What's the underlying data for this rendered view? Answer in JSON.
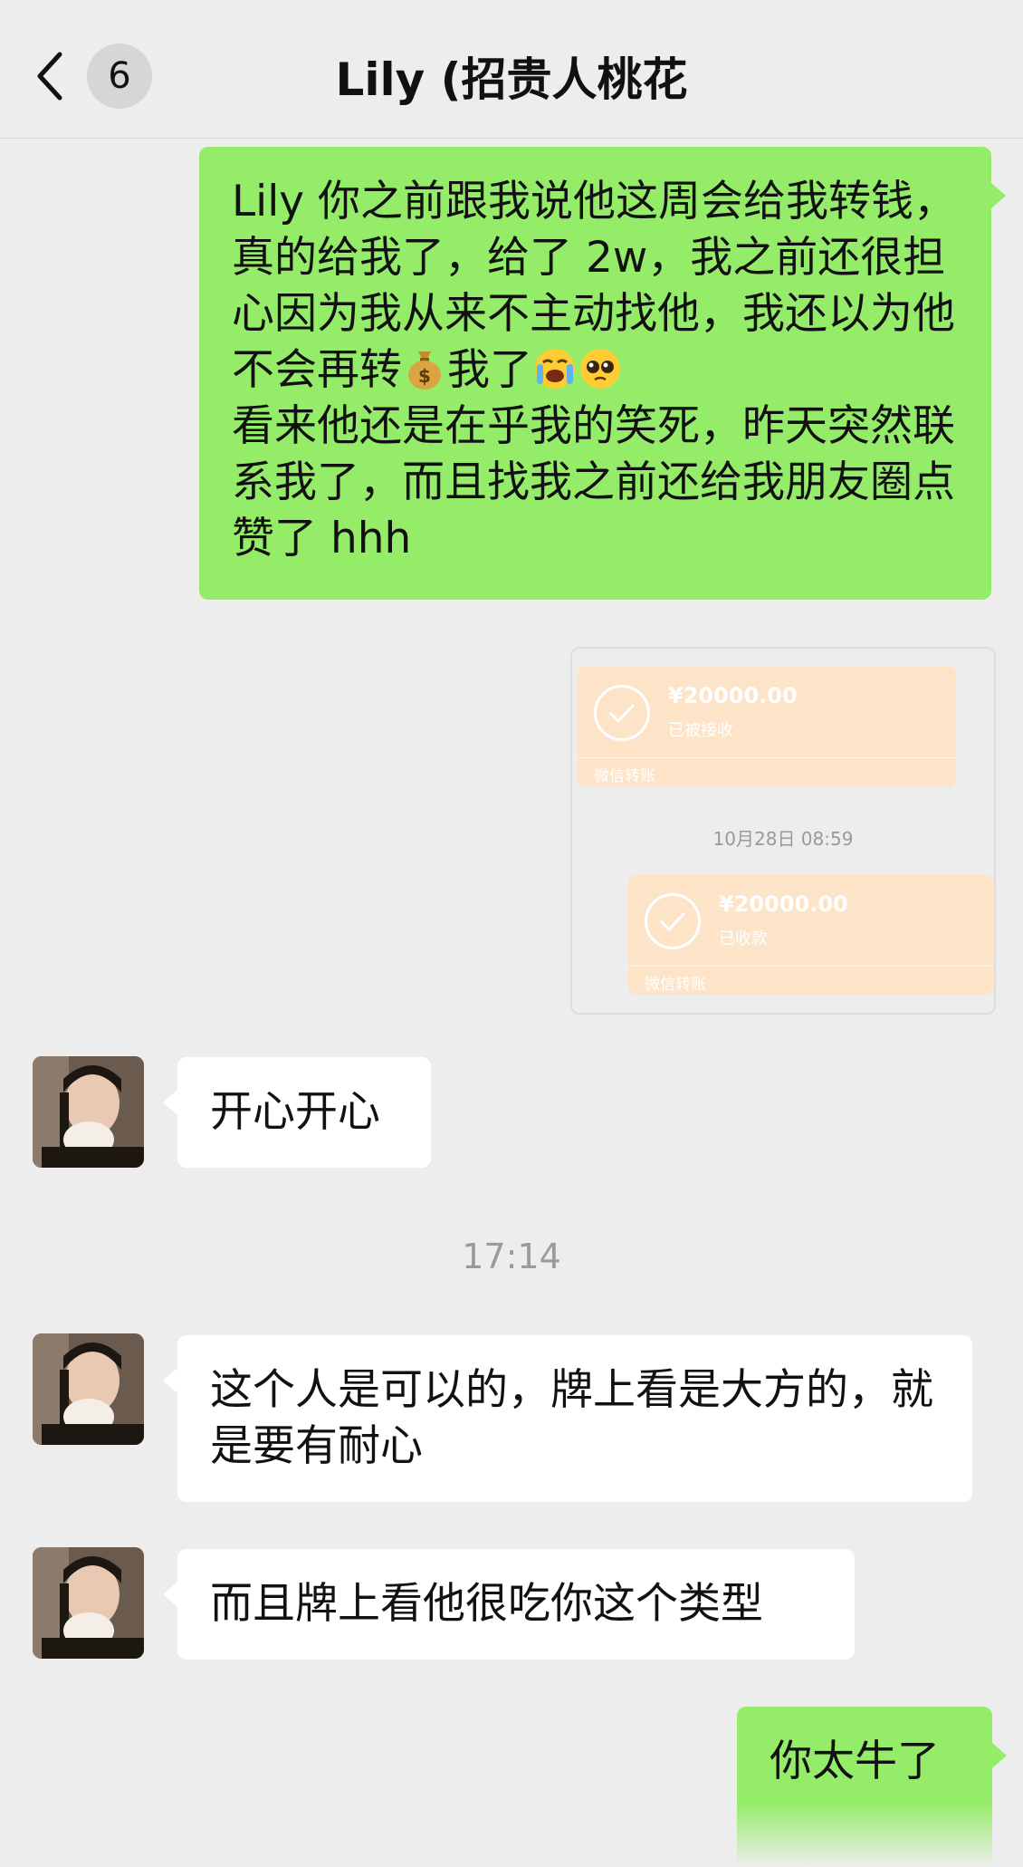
{
  "header": {
    "unread_count": "6",
    "title": "Lily (招贵人桃花"
  },
  "messages": {
    "m1": {
      "part1": "Lily 你之前跟我说他这周会给我转钱，真的给我了，给了 2w，我之前还很担心因为我从来不主动找他，我还以为他不会再转",
      "part2": "我了",
      "part3": "看来他还是在乎我的笑死，昨天突然联系我了，而且找我之前还给我朋友圈点赞了 hhh"
    },
    "kaixin": "开心开心",
    "zhege": "这个人是可以的，牌上看是大方的，就是要有耐心",
    "erqie": "而且牌上看他很吃你这个类型",
    "tainiu": "你太牛了"
  },
  "time_divider": "17:14",
  "transfer_screenshot": {
    "card1": {
      "amount": "¥20000.00",
      "status": "已被接收",
      "footer": "微信转账"
    },
    "time": "10月28日 08:59",
    "card2": {
      "amount": "¥20000.00",
      "status": "已收款",
      "footer": "微信转账"
    }
  },
  "icons": {
    "back": "chevron-left-icon",
    "money_bag": "money-bag-emoji",
    "crying": "loudly-crying-emoji",
    "pleading": "pleading-face-emoji",
    "check": "check-circle-icon"
  },
  "colors": {
    "background": "#ededed",
    "sent_bubble": "#95ec69",
    "received_bubble": "#ffffff",
    "transfer_card": "#fde3c8"
  }
}
